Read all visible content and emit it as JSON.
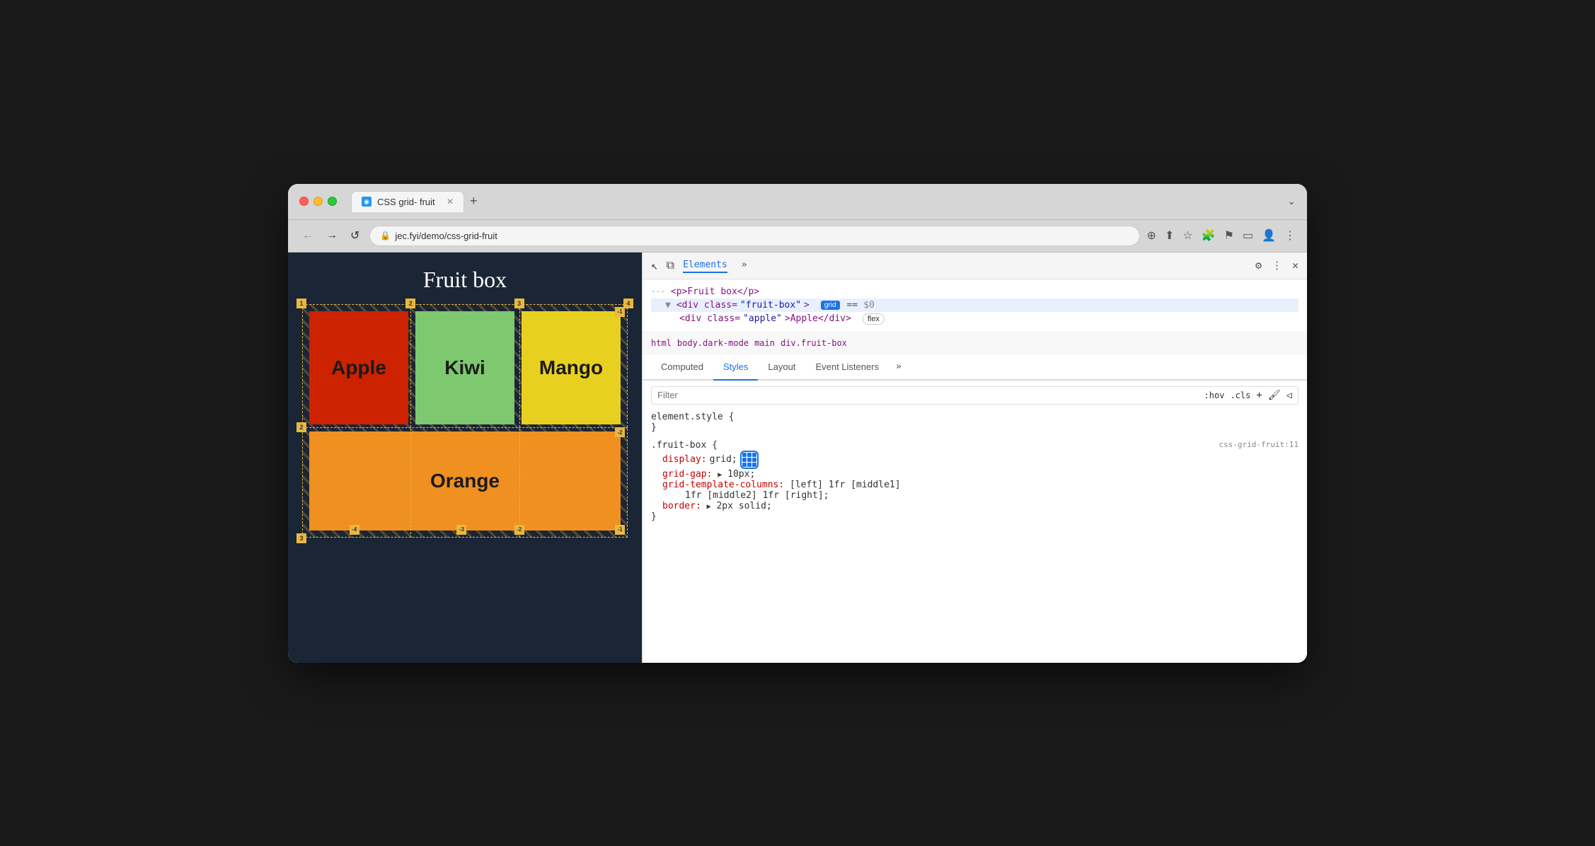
{
  "browser": {
    "tab_title": "CSS grid- fruit",
    "tab_favicon": "◉",
    "url": "jec.fyi/demo/css-grid-fruit",
    "chevron": "⌄"
  },
  "nav": {
    "back": "←",
    "forward": "→",
    "refresh": "↺"
  },
  "webpage": {
    "title": "Fruit box",
    "cells": [
      {
        "label": "Apple",
        "color": "#cc2200"
      },
      {
        "label": "Kiwi",
        "color": "#7ec870"
      },
      {
        "label": "Mango",
        "color": "#e8d020"
      },
      {
        "label": "Orange",
        "color": "#f09020"
      }
    ]
  },
  "devtools": {
    "toolbar_icons": [
      "cursor",
      "layers"
    ],
    "main_tab": "Elements",
    "more_tabs": "»",
    "settings_icon": "⚙",
    "more_icon": "⋮",
    "close_icon": "✕"
  },
  "html_tree": {
    "line1": "<p>Fruit box</p>",
    "line2_pre": "<div class=\"fruit-box\">",
    "line2_badge": "grid",
    "line2_eq": "==",
    "line2_dollar": "$0",
    "line3_pre": "<div class=\"apple\">Apple</div>",
    "line3_badge": "flex"
  },
  "breadcrumbs": [
    "html",
    "body.dark-mode",
    "main",
    "div.fruit-box"
  ],
  "panel_tabs": [
    "Computed",
    "Styles",
    "Layout",
    "Event Listeners",
    "»"
  ],
  "active_panel_tab": "Styles",
  "filter": {
    "placeholder": "Filter",
    "pseudo": ":hov",
    "cls": ".cls",
    "plus": "+",
    "paint_icon": "🖌",
    "arrow_icon": "◁"
  },
  "css_rules": [
    {
      "selector": "element.style {",
      "close": "}",
      "source": ""
    },
    {
      "selector": ".fruit-box {",
      "source": "css-grid-fruit:11",
      "close": "}",
      "props": [
        {
          "prop": "display:",
          "val": "grid;"
        },
        {
          "prop": "grid-gap:",
          "val": "▶ 10px;",
          "has_triangle": true
        },
        {
          "prop": "grid-template-columns:",
          "val": "[left] 1fr [middle1]"
        },
        {
          "val2": "    1fr [middle2] 1fr [right];"
        },
        {
          "prop": "border:",
          "val": "▶ 2px solid;",
          "has_triangle": true
        }
      ]
    }
  ]
}
